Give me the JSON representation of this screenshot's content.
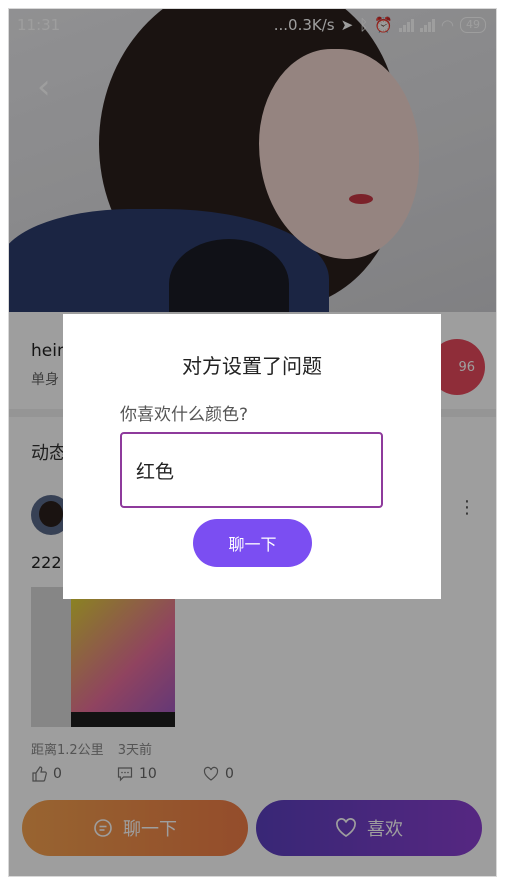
{
  "status_bar": {
    "time": "11:31",
    "net_speed": "...0.3K/s",
    "battery": "49"
  },
  "profile": {
    "name": "hein",
    "status": "单身",
    "heart_count": "96"
  },
  "dynamics": {
    "title": "动态",
    "post": {
      "text": "222",
      "distance": "距离1.2公里",
      "time": "3天前",
      "likes": "0",
      "comments": "10",
      "favorites": "0"
    }
  },
  "bottom_bar": {
    "chat_label": "聊一下",
    "like_label": "喜欢"
  },
  "dialog": {
    "title": "对方设置了问题",
    "question": "你喜欢什么颜色?",
    "answer": "红色",
    "button_label": "聊一下"
  },
  "colors": {
    "accent_purple": "#7b4ef2",
    "input_border": "#8e3a9c",
    "chat_orange": "#ef7c46",
    "like_purple": "#6a3fc7"
  }
}
